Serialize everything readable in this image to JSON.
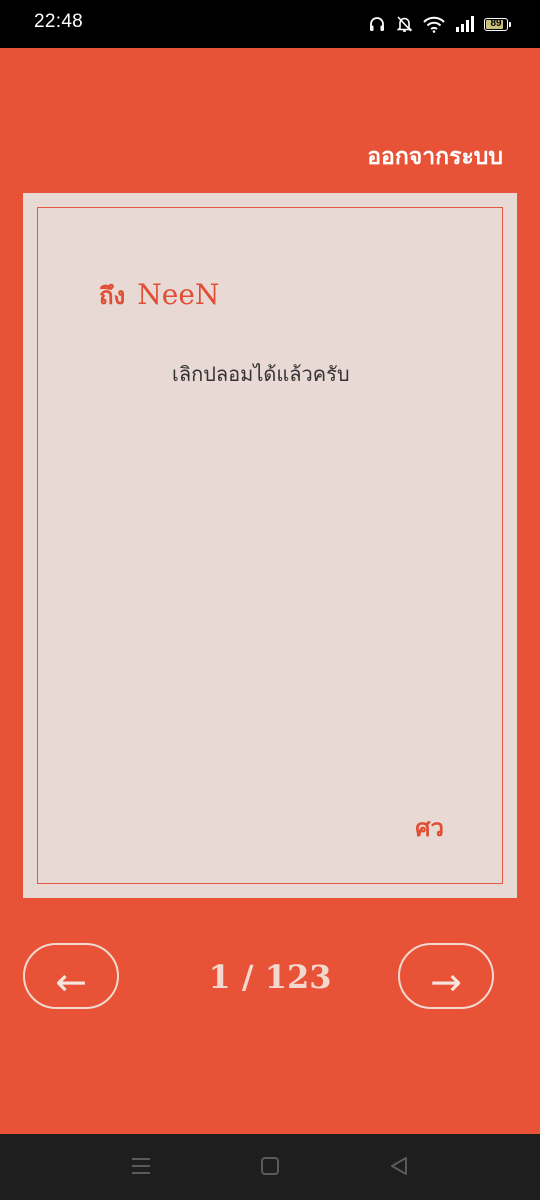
{
  "status_bar": {
    "time": "22:48",
    "battery_level": "89",
    "icons": [
      "headphones-icon",
      "bell-muted-icon",
      "wifi-icon",
      "signal-icon",
      "battery-icon"
    ]
  },
  "header": {
    "logout_label": "ออกจากระบบ"
  },
  "letter": {
    "recipient_prefix": "ถึง",
    "recipient_name": "NeeN",
    "message": "เลิกปลอมได้แล้วครับ",
    "signature": "ศว"
  },
  "pagination": {
    "prev_label": "←",
    "next_label": "→",
    "indicator": "1 / 123"
  },
  "navigation_bar": {
    "icons": [
      "menu-icon",
      "home-icon",
      "back-icon"
    ]
  },
  "colors": {
    "background": "#E85236",
    "card": "#E8D9D5",
    "accent": "#E04E33",
    "light_text": "#F3D8CF"
  }
}
